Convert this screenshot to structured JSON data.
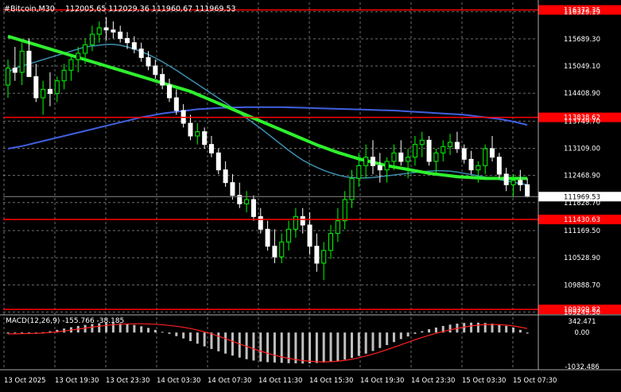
{
  "header": {
    "symbol_label": "#Bitcoin,M30",
    "ohlc": "112005.65 112029.36 111960.67 111969.53"
  },
  "colors": {
    "background": "#000000",
    "grid": "#c8c8c8",
    "bull_candle": "#00ff00",
    "bear_candle": "#ffffff",
    "ma_fast": "#3b8fb0",
    "ma_mid": "#4060e0",
    "ma_slow": "#2ef02e",
    "level_line": "#ff0000",
    "macd_signal": "#ff2020",
    "macd_hist": "#c0c0c0"
  },
  "chart_data": [
    {
      "type": "candlestick",
      "title": "#Bitcoin,M30",
      "ylim": [
        109200,
        116550
      ],
      "yticks": [
        "116329.19",
        "115689.30",
        "115049.10",
        "114408.90",
        "113749.70",
        "113109.00",
        "112468.90",
        "111828.70",
        "111169.50",
        "110528.90",
        "109888.70",
        "109249.50"
      ],
      "current_price": "111969.53",
      "levels": [
        {
          "value": 116372.35,
          "label": "116372.35"
        },
        {
          "value": 113838.62,
          "label": "113838.62"
        },
        {
          "value": 111430.63,
          "label": "111430.63"
        },
        {
          "value": 109309.82,
          "label": "109309.82"
        }
      ],
      "xticks": [
        "13 Oct 2025",
        "13 Oct 19:30",
        "13 Oct 23:30",
        "14 Oct 03:30",
        "14 Oct 07:30",
        "14 Oct 11:30",
        "14 Oct 15:30",
        "14 Oct 19:30",
        "14 Oct 23:30",
        "15 Oct 03:30",
        "15 Oct 07:30"
      ],
      "candles": [
        [
          114600,
          115200,
          114300,
          115000
        ],
        [
          115000,
          115500,
          114700,
          114900
        ],
        [
          114900,
          115600,
          114600,
          115400
        ],
        [
          115400,
          115700,
          115000,
          114800
        ],
        [
          114800,
          115100,
          114200,
          114300
        ],
        [
          114300,
          114700,
          113900,
          114500
        ],
        [
          114500,
          114900,
          114100,
          114400
        ],
        [
          114400,
          114800,
          114200,
          114700
        ],
        [
          114700,
          115100,
          114500,
          114950
        ],
        [
          114950,
          115300,
          114700,
          115200
        ],
        [
          115200,
          115500,
          114900,
          115350
        ],
        [
          115350,
          115700,
          115100,
          115550
        ],
        [
          115550,
          116000,
          115400,
          115800
        ],
        [
          115800,
          116100,
          115600,
          115950
        ],
        [
          115950,
          116200,
          115650,
          115900
        ],
        [
          115900,
          116100,
          115700,
          115850
        ],
        [
          115850,
          116000,
          115600,
          115700
        ],
        [
          115700,
          115850,
          115450,
          115600
        ],
        [
          115600,
          115750,
          115350,
          115450
        ],
        [
          115450,
          115600,
          115150,
          115250
        ],
        [
          115250,
          115400,
          114950,
          115050
        ],
        [
          115050,
          115200,
          114750,
          114850
        ],
        [
          114850,
          115000,
          114500,
          114600
        ],
        [
          114600,
          114750,
          114200,
          114300
        ],
        [
          114300,
          114500,
          113900,
          114000
        ],
        [
          114000,
          114150,
          113600,
          113700
        ],
        [
          113700,
          113900,
          113300,
          113400
        ],
        [
          113400,
          113700,
          113200,
          113500
        ],
        [
          113500,
          113600,
          113100,
          113200
        ],
        [
          113200,
          113400,
          112900,
          113000
        ],
        [
          113000,
          113100,
          112500,
          112600
        ],
        [
          112600,
          112800,
          112200,
          112300
        ],
        [
          112300,
          112500,
          111900,
          112000
        ],
        [
          112000,
          112300,
          111700,
          111800
        ],
        [
          111800,
          112100,
          111600,
          111900
        ],
        [
          111900,
          112000,
          111400,
          111500
        ],
        [
          111500,
          111700,
          111100,
          111200
        ],
        [
          111200,
          111400,
          110700,
          110800
        ],
        [
          110800,
          111200,
          110400,
          110550
        ],
        [
          110550,
          111100,
          110400,
          110900
        ],
        [
          110900,
          111400,
          110700,
          111200
        ],
        [
          111200,
          111700,
          111000,
          111500
        ],
        [
          111500,
          111700,
          111100,
          111300
        ],
        [
          111300,
          111600,
          110600,
          110800
        ],
        [
          110800,
          111100,
          110200,
          110400
        ],
        [
          110400,
          110900,
          110000,
          110700
        ],
        [
          110700,
          111300,
          110500,
          111100
        ],
        [
          111100,
          111700,
          110900,
          111400
        ],
        [
          111400,
          112100,
          111200,
          111900
        ],
        [
          111900,
          112600,
          111700,
          112400
        ],
        [
          112400,
          113000,
          112200,
          112700
        ],
        [
          112700,
          113200,
          112400,
          112900
        ],
        [
          112900,
          113300,
          112500,
          112700
        ],
        [
          112700,
          113000,
          112300,
          112600
        ],
        [
          112600,
          112900,
          112300,
          112800
        ],
        [
          112800,
          113200,
          112600,
          113000
        ],
        [
          113000,
          113300,
          112700,
          112800
        ],
        [
          112800,
          113100,
          112400,
          112900
        ],
        [
          112900,
          113400,
          112700,
          113200
        ],
        [
          113200,
          113500,
          112900,
          113300
        ],
        [
          113300,
          113400,
          112700,
          112800
        ],
        [
          112800,
          113100,
          112500,
          113000
        ],
        [
          113000,
          113300,
          112800,
          113150
        ],
        [
          113150,
          113450,
          112950,
          113250
        ],
        [
          113250,
          113500,
          113000,
          113100
        ],
        [
          113100,
          113200,
          112750,
          112850
        ],
        [
          112850,
          113050,
          112500,
          112600
        ],
        [
          112600,
          112800,
          112300,
          112700
        ],
        [
          112700,
          113200,
          112500,
          113100
        ],
        [
          113100,
          113400,
          112800,
          112900
        ],
        [
          112900,
          113000,
          112400,
          112500
        ],
        [
          112500,
          112650,
          112100,
          112250
        ],
        [
          112250,
          112500,
          111950,
          112350
        ],
        [
          112350,
          112600,
          112100,
          112250
        ],
        [
          112250,
          112400,
          111950,
          111970
        ]
      ],
      "ma_slow": [
        115750,
        115700,
        115650,
        115600,
        115550,
        115500,
        115450,
        115400,
        115350,
        115300,
        115250,
        115200,
        115150,
        115100,
        115050,
        115000,
        114950,
        114900,
        114850,
        114800,
        114750,
        114700,
        114650,
        114600,
        114550,
        114500,
        114450,
        114380,
        114310,
        114240,
        114170,
        114100,
        114030,
        113960,
        113890,
        113820,
        113750,
        113680,
        113610,
        113540,
        113470,
        113400,
        113330,
        113260,
        113190,
        113130,
        113070,
        113010,
        112960,
        112910,
        112860,
        112820,
        112780,
        112740,
        112700,
        112670,
        112640,
        112610,
        112580,
        112550,
        112520,
        112500,
        112480,
        112460,
        112440,
        112430,
        112420,
        112410,
        112400,
        112400,
        112400,
        112400,
        112400,
        112400,
        112400
      ],
      "ma_fast": [
        114900,
        115000,
        115050,
        115100,
        115150,
        115200,
        115250,
        115300,
        115350,
        115400,
        115450,
        115500,
        115520,
        115540,
        115560,
        115560,
        115540,
        115500,
        115450,
        115390,
        115320,
        115240,
        115150,
        115050,
        114950,
        114840,
        114730,
        114620,
        114510,
        114400,
        114290,
        114180,
        114060,
        113940,
        113820,
        113700,
        113580,
        113450,
        113320,
        113190,
        113060,
        112940,
        112830,
        112740,
        112660,
        112590,
        112530,
        112480,
        112440,
        112420,
        112410,
        112410,
        112420,
        112440,
        112460,
        112480,
        112500,
        112520,
        112540,
        112560,
        112570,
        112580,
        112580,
        112570,
        112550,
        112520,
        112490,
        112460,
        112430,
        112400,
        112370,
        112340,
        112310,
        112280,
        112250
      ],
      "ma_mid": [
        113100,
        113130,
        113160,
        113200,
        113240,
        113280,
        113320,
        113360,
        113400,
        113440,
        113480,
        113520,
        113560,
        113600,
        113640,
        113680,
        113720,
        113760,
        113800,
        113840,
        113870,
        113900,
        113930,
        113950,
        113970,
        113990,
        114010,
        114030,
        114040,
        114050,
        114060,
        114065,
        114070,
        114075,
        114080,
        114080,
        114080,
        114080,
        114080,
        114080,
        114075,
        114070,
        114065,
        114060,
        114055,
        114050,
        114045,
        114040,
        114035,
        114030,
        114025,
        114020,
        114015,
        114010,
        114005,
        114000,
        113990,
        113980,
        113970,
        113960,
        113950,
        113940,
        113930,
        113920,
        113910,
        113900,
        113880,
        113860,
        113840,
        113820,
        113800,
        113770,
        113740,
        113700,
        113660
      ]
    },
    {
      "type": "bar",
      "title": "MACD(12,26,9) -155.766 -38.185",
      "ylim": [
        -1032.486,
        342.471
      ],
      "yticks": [
        "342.471",
        "0.00",
        "-1032.486"
      ],
      "histogram": [
        -30,
        -20,
        -15,
        -10,
        -5,
        10,
        40,
        80,
        120,
        160,
        200,
        230,
        260,
        280,
        290,
        290,
        280,
        260,
        230,
        190,
        140,
        80,
        20,
        -40,
        -110,
        -180,
        -260,
        -340,
        -420,
        -500,
        -570,
        -640,
        -700,
        -760,
        -810,
        -850,
        -880,
        -900,
        -910,
        -920,
        -930,
        -935,
        -940,
        -935,
        -925,
        -910,
        -890,
        -860,
        -820,
        -770,
        -710,
        -640,
        -560,
        -470,
        -380,
        -290,
        -200,
        -120,
        -40,
        40,
        100,
        150,
        200,
        240,
        270,
        290,
        300,
        300,
        290,
        270,
        240,
        200,
        150,
        80,
        -30
      ],
      "signal": [
        -40,
        -40,
        -35,
        -30,
        -25,
        -15,
        0,
        20,
        45,
        75,
        105,
        135,
        165,
        190,
        215,
        235,
        250,
        260,
        265,
        265,
        260,
        250,
        235,
        215,
        190,
        160,
        120,
        75,
        20,
        -40,
        -110,
        -185,
        -265,
        -345,
        -420,
        -495,
        -565,
        -630,
        -690,
        -740,
        -785,
        -820,
        -850,
        -870,
        -885,
        -890,
        -885,
        -870,
        -845,
        -810,
        -765,
        -715,
        -655,
        -590,
        -520,
        -445,
        -370,
        -295,
        -220,
        -150,
        -85,
        -25,
        30,
        80,
        125,
        165,
        200,
        225,
        240,
        245,
        240,
        225,
        200,
        165,
        120
      ]
    }
  ]
}
